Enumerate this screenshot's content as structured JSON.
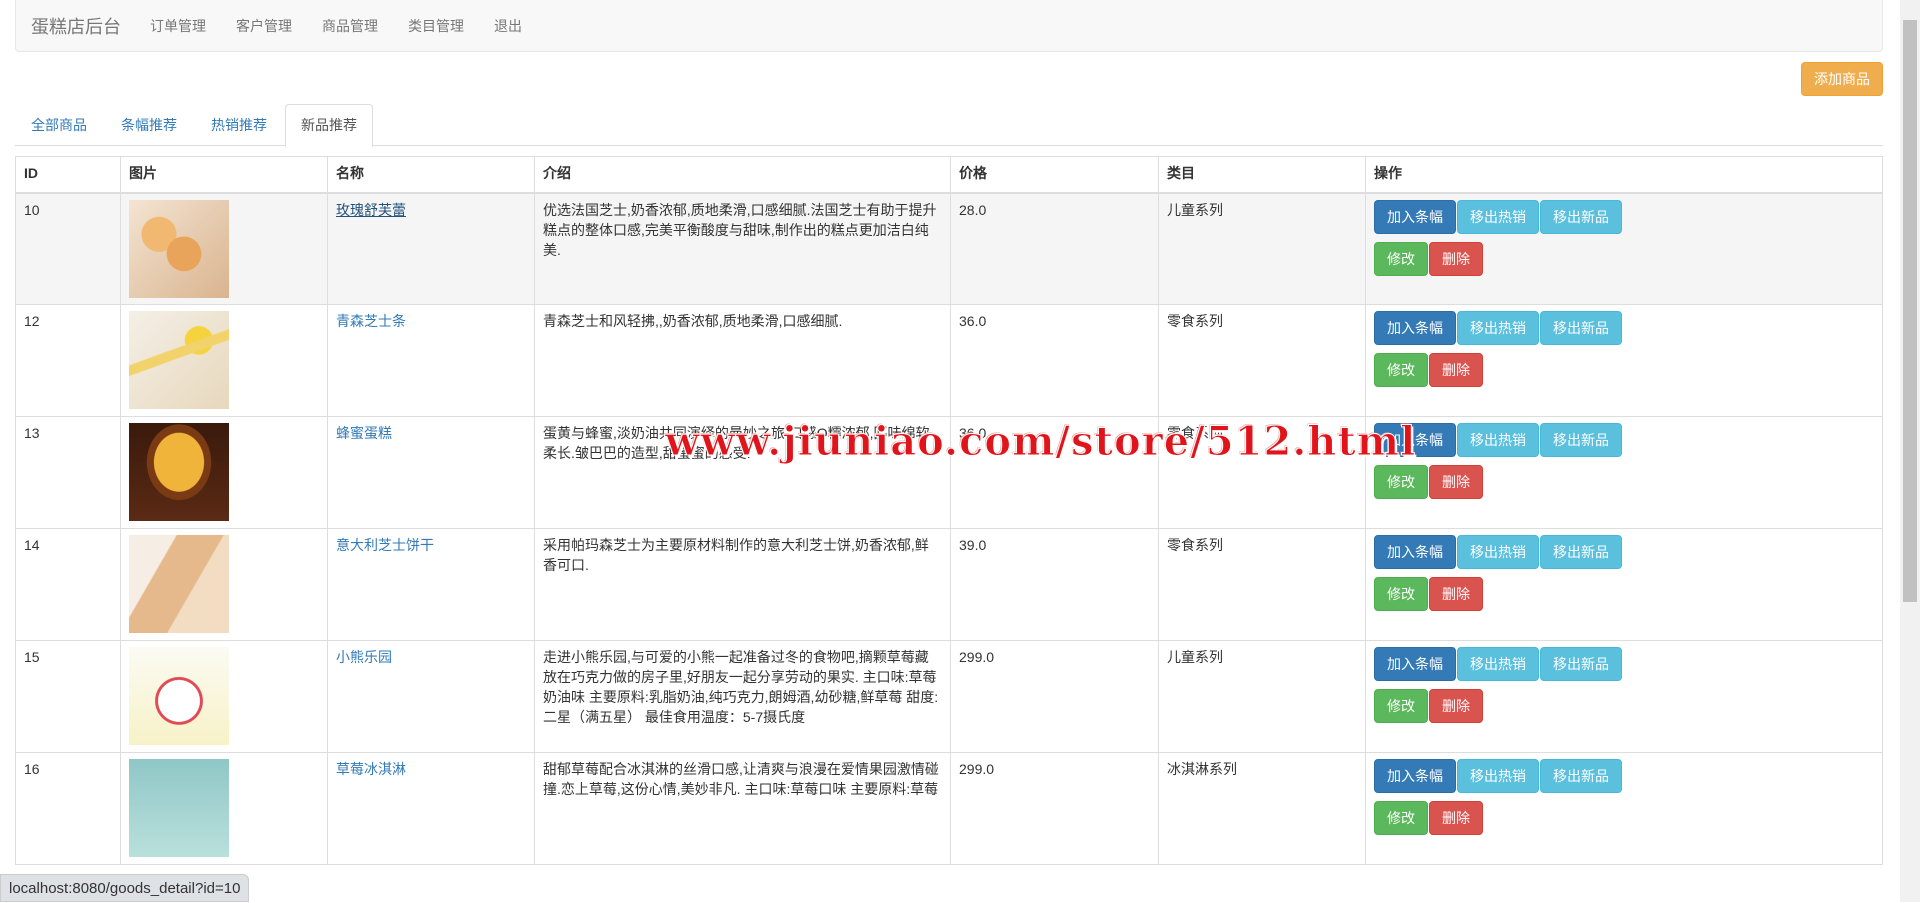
{
  "navbar": {
    "brand": "蛋糕店后台",
    "items": [
      "订单管理",
      "客户管理",
      "商品管理",
      "类目管理",
      "退出"
    ]
  },
  "add_button": "添加商品",
  "tabs": [
    "全部商品",
    "条幅推荐",
    "热销推荐",
    "新品推荐"
  ],
  "active_tab": 3,
  "table": {
    "headers": [
      "ID",
      "图片",
      "名称",
      "介绍",
      "价格",
      "类目",
      "操作"
    ],
    "rows": [
      {
        "id": "10",
        "name": "玫瑰舒芙蕾",
        "intro": "优选法国芝士,奶香浓郁,质地柔滑,口感细腻.法国芝士有助于提升糕点的整体口感,完美平衡酸度与甜味,制作出的糕点更加洁白纯美.",
        "price": "28.0",
        "category": "儿童系列"
      },
      {
        "id": "12",
        "name": "青森芝士条",
        "intro": "青森芝士和风轻拂,,奶香浓郁,质地柔滑,口感细腻.",
        "price": "36.0",
        "category": "零食系列"
      },
      {
        "id": "13",
        "name": "蜂蜜蛋糕",
        "intro": "蛋黄与蜂蜜,淡奶油共同演绎的曼妙之旅.口感Q糯浓郁,回味绵软柔长.皱巴巴的造型,甜蜜蜜的感受.",
        "price": "36.0",
        "category": "零食系列"
      },
      {
        "id": "14",
        "name": "意大利芝士饼干",
        "intro": "采用帕玛森芝士为主要原材料制作的意大利芝士饼,奶香浓郁,鲜香可口.",
        "price": "39.0",
        "category": "零食系列"
      },
      {
        "id": "15",
        "name": "小熊乐园",
        "intro": "走进小熊乐园,与可爱的小熊一起准备过冬的食物吧,摘颗草莓藏放在巧克力做的房子里,好朋友一起分享劳动的果实. 主口味:草莓奶油味 主要原料:乳脂奶油,纯巧克力,朗姆酒,幼砂糖,鲜草莓 甜度:二星（满五星） 最佳食用温度：5-7摄氏度",
        "price": "299.0",
        "category": "儿童系列"
      },
      {
        "id": "16",
        "name": "草莓冰淇淋",
        "intro": "甜郁草莓配合冰淇淋的丝滑口感,让清爽与浪漫在爱情果园激情碰撞.恋上草莓,这份心情,美妙非凡. 主口味:草莓口味 主要原料:草莓",
        "price": "299.0",
        "category": "冰淇淋系列"
      }
    ],
    "actions": {
      "add_banner": "加入条幅",
      "remove_hot": "移出热销",
      "remove_new": "移出新品",
      "edit": "修改",
      "delete": "删除"
    }
  },
  "watermark": "www.jiuniao.com/store/512.html",
  "status_url": "localhost:8080/goods_detail?id=10",
  "colors": {
    "primary": "#337ab7",
    "info": "#5bc0de",
    "success": "#5cb85c",
    "danger": "#d9534f",
    "warning": "#f0ad4e"
  }
}
